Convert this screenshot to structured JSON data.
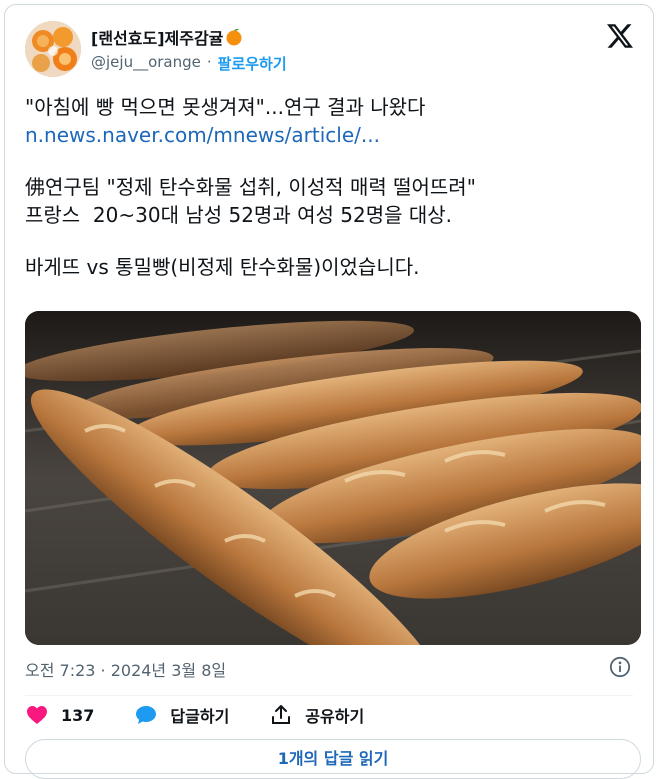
{
  "author": {
    "display_name": "[랜선효도]제주감귤",
    "handle": "@jeju__orange",
    "separator": "·",
    "follow_label": "팔로우하기"
  },
  "tweet": {
    "line1": "\"아침에 빵 먹으면 못생겨져\"...연구 결과 나왔다",
    "link": "n.news.naver.com/mnews/article/...",
    "line2": "佛연구팀 \"정제 탄수화물 섭취, 이성적 매력 떨어뜨려\"",
    "line3": "프랑스  20~30대 남성 52명과 여성 52명을 대상.",
    "line4": "바게뜨 vs 통밀빵(비정제 탄수화물)이었습니다."
  },
  "timestamp": "오전 7:23 · 2024년 3월 8일",
  "actions": {
    "like_count": "137",
    "reply_label": "답글하기",
    "share_label": "공유하기"
  },
  "replies_button": "1개의 답글 읽기",
  "colors": {
    "like": "#f91880",
    "reply": "#1d9bf0",
    "link": "#1d68b8",
    "muted": "#536471"
  }
}
